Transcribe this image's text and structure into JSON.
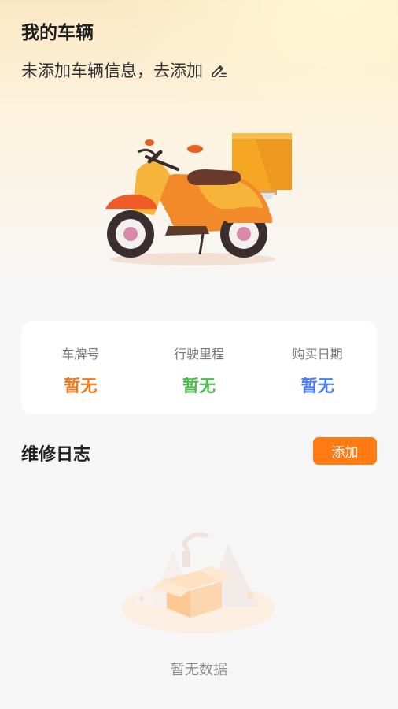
{
  "header": {
    "title": "我的车辆",
    "subtitle": "未添加车辆信息，去添加",
    "edit_icon": "edit-pen-icon"
  },
  "vehicle": {
    "illustration": "scooter-delivery-illustration"
  },
  "stats": [
    {
      "label": "车牌号",
      "value": "暂无",
      "color": "#f07a1e"
    },
    {
      "label": "行驶里程",
      "value": "暂无",
      "color": "#4cbb4c"
    },
    {
      "label": "购买日期",
      "value": "暂无",
      "color": "#4a7df0"
    }
  ],
  "maintenance": {
    "title": "维修日志",
    "add_label": "添加",
    "empty_text": "暂无数据",
    "empty_icon": "empty-box-icon"
  },
  "colors": {
    "accent": "#ff7a12",
    "background": "#f6f6f6"
  }
}
